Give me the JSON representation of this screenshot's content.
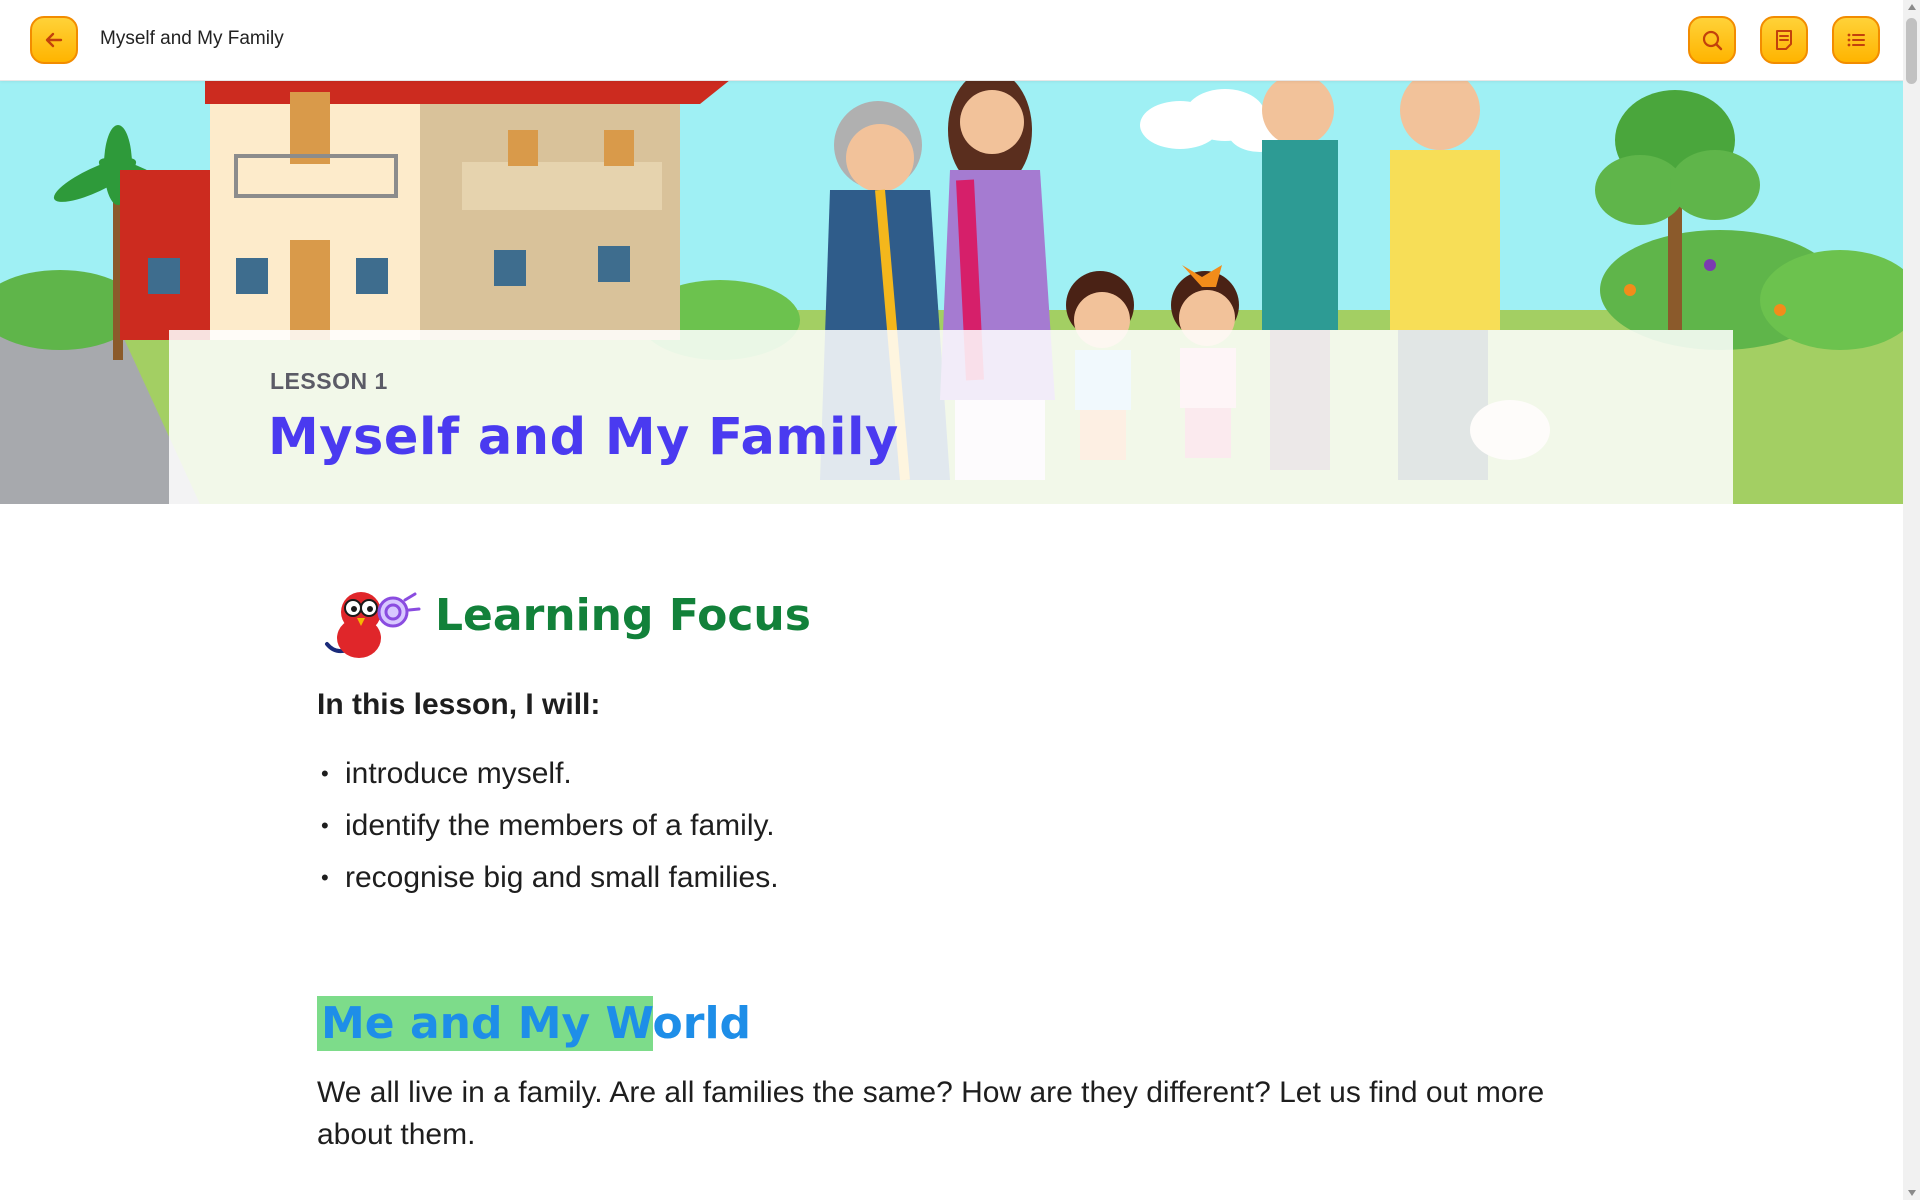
{
  "topbar": {
    "title": "Myself and My Family",
    "back_icon": "arrow-left-icon",
    "search_icon": "search-icon",
    "notes_icon": "notes-icon",
    "toc_icon": "list-icon",
    "accent": "#ffbf1a"
  },
  "hero": {
    "lesson_label": "LESSON 1",
    "lesson_title": "Myself and My Family"
  },
  "learning_focus": {
    "title": "Learning Focus",
    "intro": "In this lesson, I will:",
    "objectives": [
      "introduce myself.",
      "identify the members of a family.",
      "recognise big and small families."
    ]
  },
  "section": {
    "title_highlighted": "Me and My W",
    "title_rest": "orld",
    "paragraph": "We all live in a family. Are all families the same? How are they different? Let us find out more about them."
  },
  "colors": {
    "lesson_title": "#4a3af0",
    "focus_title": "#12813a",
    "section_title": "#1e8ee8",
    "highlight": "#7ddc8a"
  }
}
